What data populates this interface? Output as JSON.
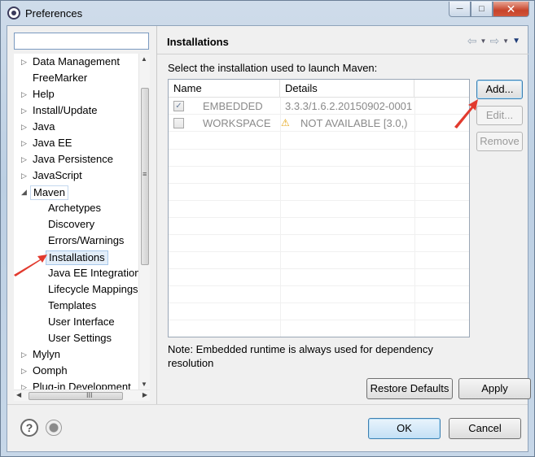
{
  "window": {
    "title": "Preferences",
    "controls": {
      "minimize": "─",
      "maximize": "□",
      "close": "✕"
    }
  },
  "tree": {
    "filter_placeholder": "",
    "items": [
      {
        "label": "Data Management",
        "arrow": "▷",
        "level": 0
      },
      {
        "label": "FreeMarker",
        "arrow": "",
        "level": 0
      },
      {
        "label": "Help",
        "arrow": "▷",
        "level": 0
      },
      {
        "label": "Install/Update",
        "arrow": "▷",
        "level": 0
      },
      {
        "label": "Java",
        "arrow": "▷",
        "level": 0
      },
      {
        "label": "Java EE",
        "arrow": "▷",
        "level": 0
      },
      {
        "label": "Java Persistence",
        "arrow": "▷",
        "level": 0
      },
      {
        "label": "JavaScript",
        "arrow": "▷",
        "level": 0
      },
      {
        "label": "Maven",
        "arrow": "◢",
        "level": 0
      },
      {
        "label": "Archetypes",
        "arrow": "",
        "level": 1
      },
      {
        "label": "Discovery",
        "arrow": "",
        "level": 1
      },
      {
        "label": "Errors/Warnings",
        "arrow": "",
        "level": 1
      },
      {
        "label": "Installations",
        "arrow": "",
        "level": 1
      },
      {
        "label": "Java EE Integration",
        "arrow": "",
        "level": 1
      },
      {
        "label": "Lifecycle Mappings",
        "arrow": "",
        "level": 1
      },
      {
        "label": "Templates",
        "arrow": "",
        "level": 1
      },
      {
        "label": "User Interface",
        "arrow": "",
        "level": 1
      },
      {
        "label": "User Settings",
        "arrow": "",
        "level": 1
      },
      {
        "label": "Mylyn",
        "arrow": "▷",
        "level": 0
      },
      {
        "label": "Oomph",
        "arrow": "▷",
        "level": 0
      },
      {
        "label": "Plug-in Development",
        "arrow": "▷",
        "level": 0
      }
    ],
    "vscroll_grip": "≡",
    "hscroll_grip": "III"
  },
  "page": {
    "title": "Installations",
    "nav": {
      "back": "⇦",
      "forward": "⇨",
      "dropdown": "▼",
      "menu": "▼"
    },
    "instruction": "Select the installation used to launch Maven:",
    "table": {
      "columns": [
        "Name",
        "Details"
      ],
      "rows": [
        {
          "checked": true,
          "check_mark": "✓",
          "name": "EMBEDDED",
          "details": "3.3.3/1.6.2.20150902-0001",
          "warning": false
        },
        {
          "checked": false,
          "check_mark": "",
          "name": "WORKSPACE",
          "details": "NOT AVAILABLE [3.0,)",
          "warning": true,
          "warning_icon": "⚠"
        }
      ]
    },
    "buttons": {
      "add": "Add...",
      "edit": "Edit...",
      "remove": "Remove"
    },
    "note": "Note: Embedded runtime is always used for dependency resolution",
    "restore_defaults": "Restore Defaults",
    "apply": "Apply"
  },
  "footer": {
    "help_glyph": "?",
    "ok": "OK",
    "cancel": "Cancel"
  },
  "colors": {
    "annotation_arrow": "#e23a2e",
    "selection_bg": "#e3eef9",
    "default_button_border": "#3c7fb1"
  }
}
